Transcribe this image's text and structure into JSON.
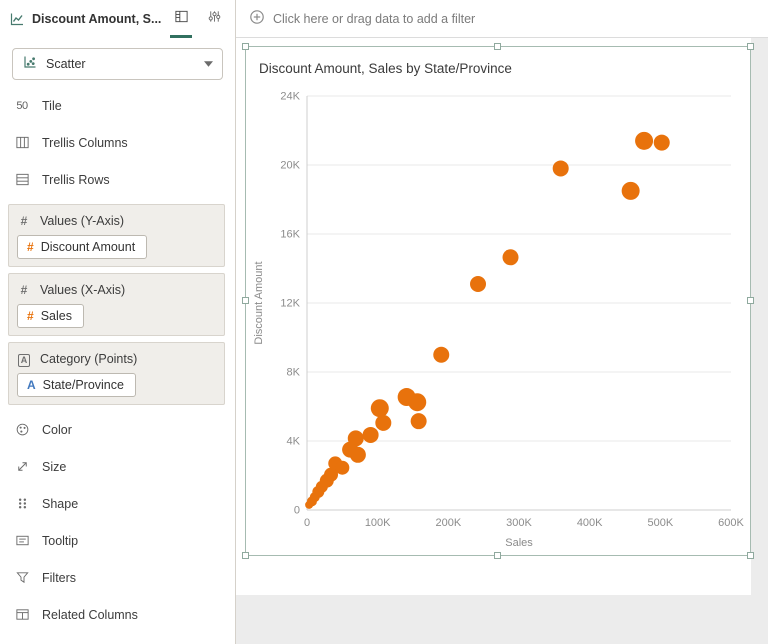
{
  "colors": {
    "accent_orange": "#e8720c",
    "attribute_blue": "#4178be",
    "active_tab_green": "#31705f",
    "selection_frame": "#a6bbb1"
  },
  "sidebar": {
    "header": {
      "title": "Discount Amount, S...",
      "tabs": [
        {
          "id": "grammar",
          "icon": "grammar-panel-icon",
          "active": true
        },
        {
          "id": "properties",
          "icon": "settings-sliders-icon",
          "active": false
        }
      ]
    },
    "viz_type": {
      "label": "Scatter",
      "icon": "scatter-chart-icon"
    },
    "rows_top": [
      {
        "id": "tile",
        "label": "Tile",
        "icon": "tile-50-icon"
      },
      {
        "id": "trellis-columns",
        "label": "Trellis Columns",
        "icon": "trellis-columns-icon"
      },
      {
        "id": "trellis-rows",
        "label": "Trellis Rows",
        "icon": "trellis-rows-icon"
      }
    ],
    "groups": [
      {
        "label": "Values (Y-Axis)",
        "type": "measure",
        "pills": [
          {
            "label": "Discount Amount",
            "type": "measure"
          }
        ]
      },
      {
        "label": "Values (X-Axis)",
        "type": "measure",
        "pills": [
          {
            "label": "Sales",
            "type": "measure"
          }
        ]
      },
      {
        "label": "Category (Points)",
        "type": "attribute",
        "pills": [
          {
            "label": "State/Province",
            "type": "attribute"
          }
        ]
      }
    ],
    "rows_bottom": [
      {
        "id": "color",
        "label": "Color",
        "icon": "color-palette-icon"
      },
      {
        "id": "size",
        "label": "Size",
        "icon": "size-resize-icon"
      },
      {
        "id": "shape",
        "label": "Shape",
        "icon": "shape-dots-icon"
      },
      {
        "id": "tooltip",
        "label": "Tooltip",
        "icon": "tooltip-box-icon"
      },
      {
        "id": "filters",
        "label": "Filters",
        "icon": "filter-funnel-icon"
      },
      {
        "id": "related-columns",
        "label": "Related Columns",
        "icon": "related-columns-icon"
      }
    ]
  },
  "filter_bar": {
    "label": "Click here or drag data to add a filter",
    "icon": "add-filter-icon"
  },
  "chart_data": {
    "type": "scatter",
    "title": "Discount Amount, Sales by State/Province",
    "xlabel": "Sales",
    "ylabel": "Discount Amount",
    "xlim": [
      0,
      600000
    ],
    "ylim": [
      0,
      24000
    ],
    "x_ticks": [
      "0",
      "100K",
      "200K",
      "300K",
      "400K",
      "500K",
      "600K"
    ],
    "y_ticks": [
      "0",
      "4K",
      "8K",
      "12K",
      "16K",
      "20K",
      "24K"
    ],
    "grid": "horizontal",
    "legend": "none",
    "point_color": "#e8720c",
    "points": [
      {
        "x": 3000,
        "y": 300,
        "r": 4
      },
      {
        "x": 7000,
        "y": 500,
        "r": 5
      },
      {
        "x": 11000,
        "y": 750,
        "r": 5
      },
      {
        "x": 16000,
        "y": 1050,
        "r": 6
      },
      {
        "x": 21000,
        "y": 1350,
        "r": 6
      },
      {
        "x": 28000,
        "y": 1700,
        "r": 7
      },
      {
        "x": 34000,
        "y": 2050,
        "r": 7
      },
      {
        "x": 40000,
        "y": 2700,
        "r": 7
      },
      {
        "x": 50000,
        "y": 2450,
        "r": 7
      },
      {
        "x": 61000,
        "y": 3500,
        "r": 8
      },
      {
        "x": 69000,
        "y": 4150,
        "r": 8
      },
      {
        "x": 72000,
        "y": 3200,
        "r": 8
      },
      {
        "x": 90000,
        "y": 4350,
        "r": 8
      },
      {
        "x": 103000,
        "y": 5900,
        "r": 9
      },
      {
        "x": 108000,
        "y": 5050,
        "r": 8
      },
      {
        "x": 141000,
        "y": 6550,
        "r": 9
      },
      {
        "x": 156000,
        "y": 6250,
        "r": 9
      },
      {
        "x": 158000,
        "y": 5150,
        "r": 8
      },
      {
        "x": 190000,
        "y": 9000,
        "r": 8
      },
      {
        "x": 242000,
        "y": 13100,
        "r": 8
      },
      {
        "x": 288000,
        "y": 14650,
        "r": 8
      },
      {
        "x": 359000,
        "y": 19800,
        "r": 8
      },
      {
        "x": 458000,
        "y": 18500,
        "r": 9
      },
      {
        "x": 477000,
        "y": 21400,
        "r": 9
      },
      {
        "x": 502000,
        "y": 21300,
        "r": 8
      }
    ]
  }
}
